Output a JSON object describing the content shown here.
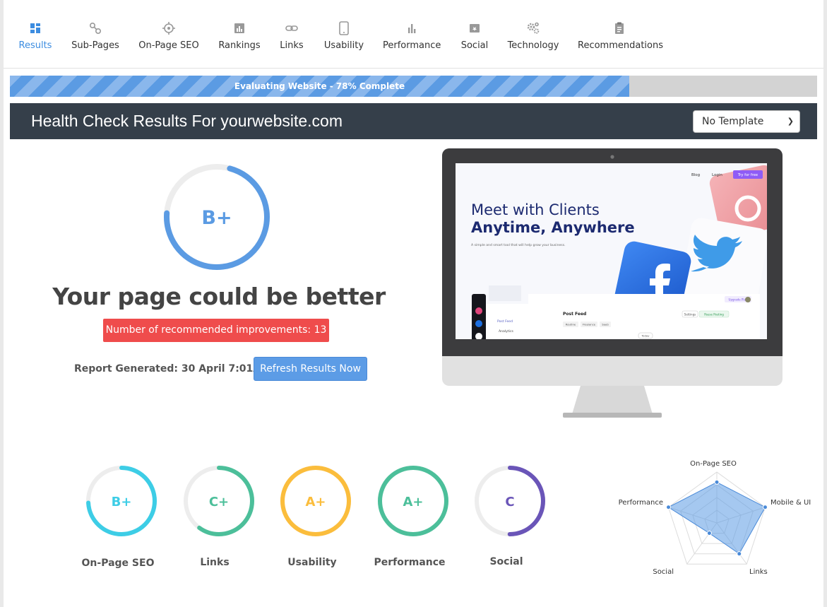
{
  "tabs": [
    {
      "label": "Results",
      "icon": "grid-icon",
      "active": true
    },
    {
      "label": "Sub-Pages",
      "icon": "link-nodes-icon"
    },
    {
      "label": "On-Page SEO",
      "icon": "target-icon"
    },
    {
      "label": "Rankings",
      "icon": "bar-square-icon"
    },
    {
      "label": "Links",
      "icon": "chain-link-icon"
    },
    {
      "label": "Usability",
      "icon": "tablet-icon"
    },
    {
      "label": "Performance",
      "icon": "bar-chart-icon"
    },
    {
      "label": "Social",
      "icon": "social-card-icon"
    },
    {
      "label": "Technology",
      "icon": "gears-icon"
    },
    {
      "label": "Recommendations",
      "icon": "clipboard-icon"
    }
  ],
  "progress": {
    "label": "Evaluating Website - 78% Complete",
    "percent": 78
  },
  "header": {
    "title": "Health Check Results For yourwebsite.com",
    "template_select": "No Template"
  },
  "summary": {
    "grade": "B+",
    "grade_progress": 0.72,
    "headline": "Your page could be better",
    "improvements_badge": "Number of recommended improvements: 13",
    "report_generated": "Report Generated: 30 April 7:01AM",
    "refresh_button": "Refresh Results Now"
  },
  "preview": {
    "nav": [
      "Blog",
      "Login",
      "Try for free"
    ],
    "headline_1": "Meet with Clients",
    "headline_2": "Anytime, Anywhere",
    "subtext": "A simple and smart tool that will help grow your business.",
    "post_feed": "Post Feed",
    "analytics": "Analytics",
    "upgrade": "Upgrade Plan",
    "settings": "Settings",
    "pause": "Pause Posting",
    "chips": [
      "Routine",
      "Freelance",
      "SaaS"
    ],
    "today": "Today"
  },
  "grades": [
    {
      "label": "On-Page SEO",
      "grade": "B+",
      "progress": 0.74,
      "color": "#3dcde6"
    },
    {
      "label": "Links",
      "grade": "C+",
      "progress": 0.6,
      "color": "#4cbf9a"
    },
    {
      "label": "Usability",
      "grade": "A+",
      "progress": 1.0,
      "color": "#fbbd3c"
    },
    {
      "label": "Performance",
      "grade": "A+",
      "progress": 1.0,
      "color": "#4cbf9a"
    },
    {
      "label": "Social",
      "grade": "C",
      "progress": 0.5,
      "color": "#6a55b8"
    }
  ],
  "radar": {
    "axes": [
      "On-Page SEO",
      "Mobile & UI",
      "Links",
      "Social",
      "Performance"
    ],
    "values": [
      0.8,
      1.0,
      0.75,
      0.25,
      1.0
    ],
    "fill": "#5b9be3"
  },
  "colors": {
    "accent": "#3d8de0",
    "header_bg": "#353f4a",
    "badge_red": "#ef4c4c",
    "button_blue": "#5c9ce6"
  }
}
